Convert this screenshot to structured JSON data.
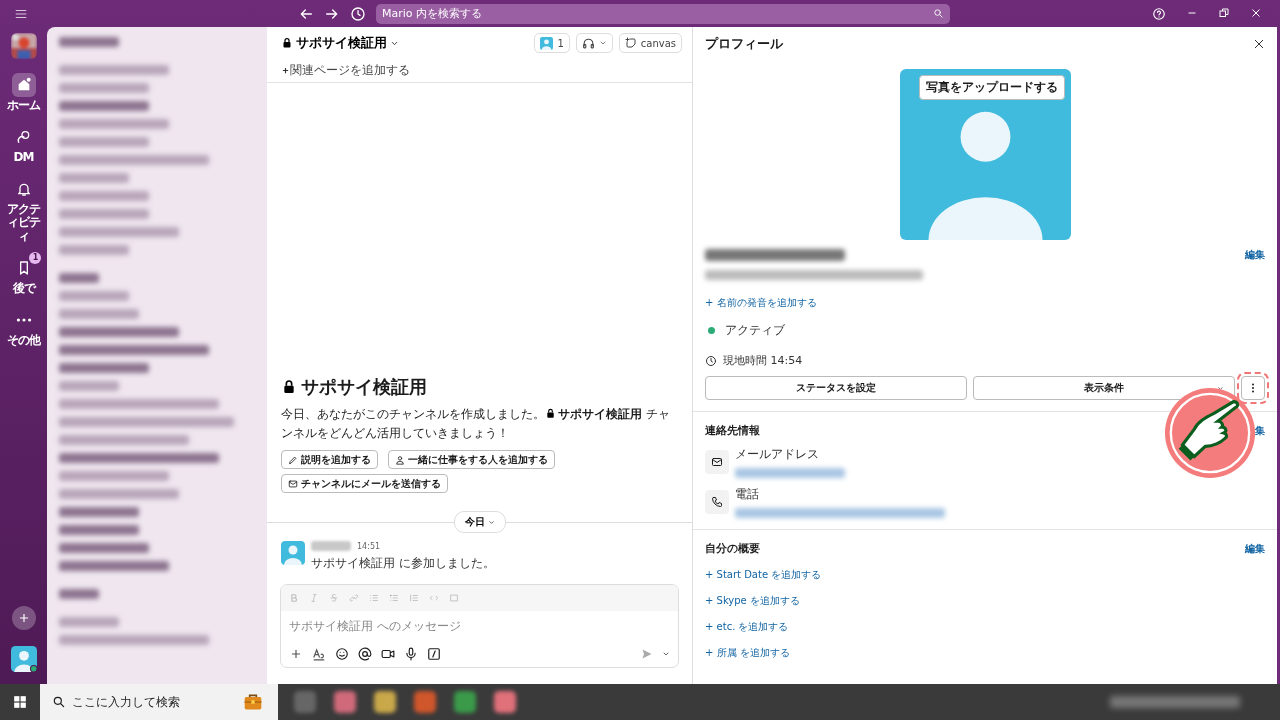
{
  "top_bar": {
    "search_placeholder": "Mario 内を検索する"
  },
  "rail": {
    "items": [
      {
        "kind": "home",
        "label": "ホーム",
        "selected": true
      },
      {
        "kind": "dm",
        "label": "DM",
        "selected": false
      },
      {
        "kind": "activity",
        "label": "アクティビティ",
        "selected": false
      },
      {
        "kind": "later",
        "label": "後で",
        "selected": false,
        "badge": "1"
      },
      {
        "kind": "more",
        "label": "その他",
        "selected": false
      }
    ]
  },
  "channel": {
    "name": "サポサイ検証用",
    "member_count": "1",
    "canvas_label": "canvas",
    "add_page": "関連ページを追加する",
    "intro_title": "サポサイ検証用",
    "intro_text": "今日、あなたがこのチャンネルを作成しました。**サポサイ検証用** チャンネルをどんどん活用していきましょう！",
    "actions": [
      {
        "kind": "pencil",
        "label": "説明を追加する"
      },
      {
        "kind": "person",
        "label": "一緒に仕事をする人を追加する"
      },
      {
        "kind": "mail",
        "label": "チャンネルにメールを送信する"
      }
    ],
    "date_divider": "今日",
    "message": {
      "time": "14:51",
      "text": "サポサイ検証用 に参加しました。"
    },
    "composer_placeholder": "サポサイ検証用 へのメッセージ"
  },
  "profile": {
    "title": "プロフィール",
    "upload_button": "写真をアップロードする",
    "edit": "編集",
    "pronunciation_link": "+ 名前の発音を追加する",
    "status": "アクティブ",
    "local_time": "現地時間 14:54",
    "status_button": "ステータスを設定",
    "view_button": "表示条件",
    "contact": {
      "title": "連絡先情報",
      "edit": "集",
      "fields": [
        {
          "kind": "mail",
          "label": "メールアドレス"
        },
        {
          "kind": "phone",
          "label": "電話"
        }
      ]
    },
    "about": {
      "title": "自分の概要",
      "edit": "編集",
      "links": [
        "+ Start Date を追加する",
        "+ Skype を追加する",
        "+ etc. を追加する",
        "+ 所属 を追加する"
      ]
    }
  },
  "taskbar": {
    "search_placeholder": "ここに入力して検索"
  }
}
